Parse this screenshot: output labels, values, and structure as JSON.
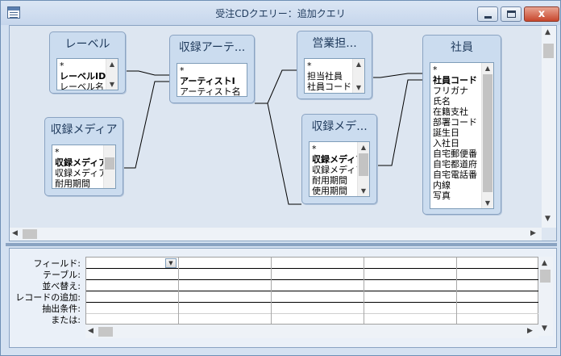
{
  "window": {
    "title": "受注CDクエリー：追加クエリ",
    "controls": {
      "minimize_icon": "minimize-icon",
      "maximize_icon": "maximize-icon",
      "close_glyph": "x"
    }
  },
  "tables": {
    "level": {
      "title": "レーベル",
      "fields": [
        "*",
        "レーベルID",
        "レーベル名"
      ],
      "key_fields": [
        "レーベルID"
      ]
    },
    "media1": {
      "title": "収録メディア",
      "fields": [
        "*",
        "収録メディア",
        "収録メディア",
        "耐用期間"
      ],
      "key_fields": [
        "収録メディア"
      ]
    },
    "artist": {
      "title": "収録アーテ...",
      "fields": [
        "*",
        "アーティストI",
        "アーティスト名"
      ],
      "key_fields": [
        "アーティストI"
      ]
    },
    "sales": {
      "title": "営業担...",
      "fields": [
        "*",
        "担当社員",
        "社員コード"
      ],
      "key_fields": []
    },
    "media2": {
      "title": "収録メデ...",
      "fields": [
        "*",
        "収録メディア",
        "収録メディア",
        "耐用期間",
        "使用期間"
      ],
      "key_fields": [
        "収録メディア"
      ]
    },
    "employee": {
      "title": "社員",
      "fields": [
        "*",
        "社員コード",
        "フリガナ",
        "氏名",
        "在籍支社",
        "部署コード",
        "誕生日",
        "入社日",
        "自宅郵便番",
        "自宅都道府",
        "自宅電話番",
        "内線",
        "写真"
      ],
      "key_fields": [
        "社員コード"
      ]
    }
  },
  "grid": {
    "row_labels": [
      "フィールド:",
      "テーブル:",
      "並べ替え:",
      "レコードの追加:",
      "抽出条件:",
      "または:"
    ]
  },
  "scrollbars": {
    "up": "▲",
    "down": "▼",
    "left": "◀",
    "right": "▶"
  },
  "colors": {
    "pane_bg": "#dde6f1",
    "table_bg": "#cbdcef",
    "title_text": "#1e395b",
    "close_button": "#c7462c"
  }
}
